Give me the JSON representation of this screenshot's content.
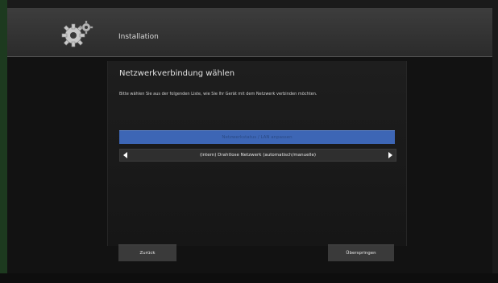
{
  "header": {
    "title": "Installation",
    "icon": "gear-icon"
  },
  "panel": {
    "title": "Netzwerkverbindung wählen",
    "description": "Bitte wählen Sie aus der folgenden Liste, wie Sie Ihr Gerät mit dem Netzwerk verbinden möchten.",
    "selected_option": "Netzwerkstatus / LAN anpassen",
    "option_row": "(intern) Drahtlose Netzwerk (automatisch/manuelle)"
  },
  "buttons": {
    "back": "Zurück",
    "skip": "Überspringen"
  },
  "colors": {
    "header": "#353535",
    "selected": "#3d66b5",
    "background": "#121212"
  }
}
